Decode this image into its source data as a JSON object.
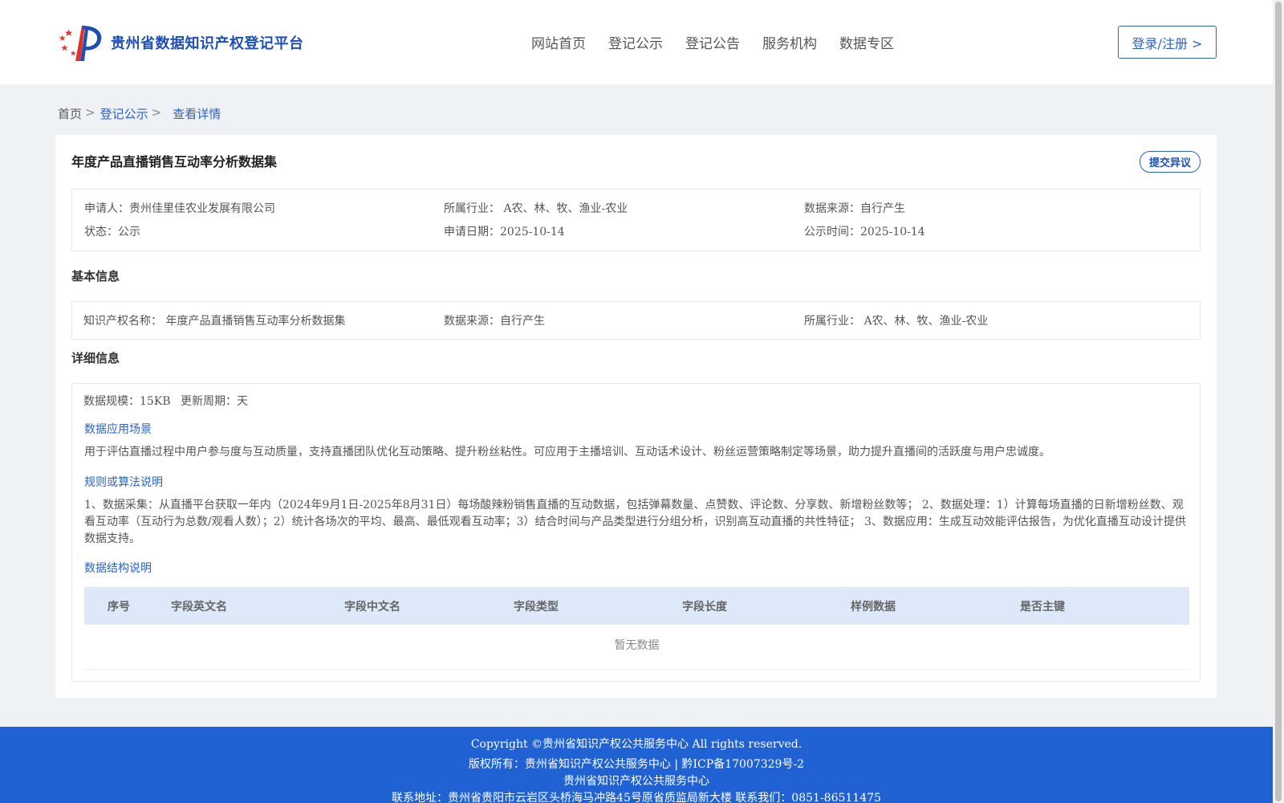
{
  "header": {
    "site_title": "贵州省数据知识产权登记平台",
    "nav": [
      "网站首页",
      "登记公示",
      "登记公告",
      "服务机构",
      "数据专区"
    ],
    "login_label": "登录/注册 >"
  },
  "breadcrumb": {
    "home": "首页",
    "sep": ">",
    "level1": "登记公示",
    "current": "查看详情"
  },
  "detail": {
    "title": "年度产品直播销售互动率分析数据集",
    "objection_label": "提交异议",
    "summary": {
      "applicant": "申请人：贵州佳里佳农业发展有限公司",
      "industry": "所属行业： A农、林、牧、渔业-农业",
      "source": "数据来源：自行产生",
      "status": "状态：公示",
      "apply_date": "申请日期：2025-10-14",
      "publish_date": "公示时间：2025-10-14"
    },
    "basic_title": "基本信息",
    "basic": {
      "ip_name": "知识产权名称： 年度产品直播销售互动率分析数据集",
      "source": "数据来源：自行产生",
      "industry": "所属行业： A农、林、牧、渔业-农业"
    },
    "detail_title": "详细信息",
    "scale": "数据规模：15KB",
    "cycle": "更新周期：天",
    "scenario_title": "数据应用场景",
    "scenario_text": "用于评估直播过程中用户参与度与互动质量，支持直播团队优化互动策略、提升粉丝粘性。可应用于主播培训、互动话术设计、粉丝运营策略制定等场景，助力提升直播间的活跃度与用户忠诚度。",
    "rules_title": "规则或算法说明",
    "rules_text": "1、数据采集：从直播平台获取一年内（2024年9月1日-2025年8月31日）每场酸辣粉销售直播的互动数据，包括弹幕数量、点赞数、评论数、分享数、新增粉丝数等； 2、数据处理：1）计算每场直播的日新增粉丝数、观看互动率（互动行为总数/观看人数）；2）统计各场次的平均、最高、最低观看互动率；3）结合时间与产品类型进行分组分析，识别高互动直播的共性特征； 3、数据应用：生成互动效能评估报告，为优化直播互动设计提供数据支持。",
    "structure_title": "数据结构说明",
    "table_headers": [
      "序号",
      "字段英文名",
      "字段中文名",
      "字段类型",
      "字段长度",
      "样例数据",
      "是否主键"
    ],
    "no_data": "暂无数据"
  },
  "footer": {
    "line1": "Copyright ©贵州省知识产权公共服务中心 All rights reserved.",
    "line2": "版权所有：贵州省知识产权公共服务中心 | 黔ICP备17007329号-2",
    "line3": "贵州省知识产权公共服务中心",
    "line4": "联系地址：贵州省贵阳市云岩区头桥海马冲路45号原省质监局新大楼 联系我们：0851-86511475"
  },
  "colors": {
    "brand_blue": "#2a62c9",
    "footer_blue": "#2062d3",
    "table_head": "#dde9f9"
  }
}
